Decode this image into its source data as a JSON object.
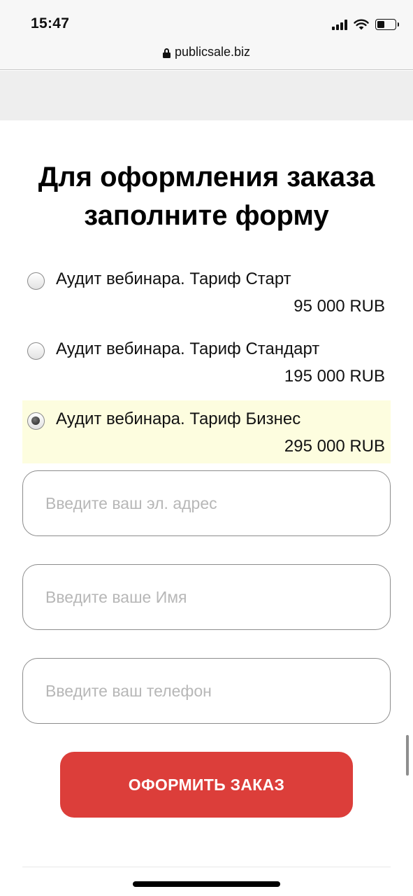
{
  "status_bar": {
    "time": "15:47",
    "icons": [
      "cellular-signal-icon",
      "wifi-icon",
      "battery-icon"
    ],
    "battery_level": 0.45
  },
  "browser": {
    "url": "publicsale.biz",
    "secure_icon": "lock-icon"
  },
  "form": {
    "title_line1": "Для оформления заказа",
    "title_line2": "заполните форму",
    "options": [
      {
        "label": "Аудит вебинара. Тариф Старт",
        "price": "95 000 RUB",
        "selected": false
      },
      {
        "label": "Аудит вебинара. Тариф Стандарт",
        "price": "195 000 RUB",
        "selected": false
      },
      {
        "label": "Аудит вебинара. Тариф Бизнес",
        "price": "295 000 RUB",
        "selected": true
      }
    ],
    "email_placeholder": "Введите ваш эл. адрес",
    "name_placeholder": "Введите ваше Имя",
    "phone_placeholder": "Введите ваш телефон",
    "submit_label": "ОФОРМИТЬ ЗАКАЗ"
  },
  "colors": {
    "accent_button": "#dc3e3a",
    "selected_option_bg": "#fdfddf"
  }
}
